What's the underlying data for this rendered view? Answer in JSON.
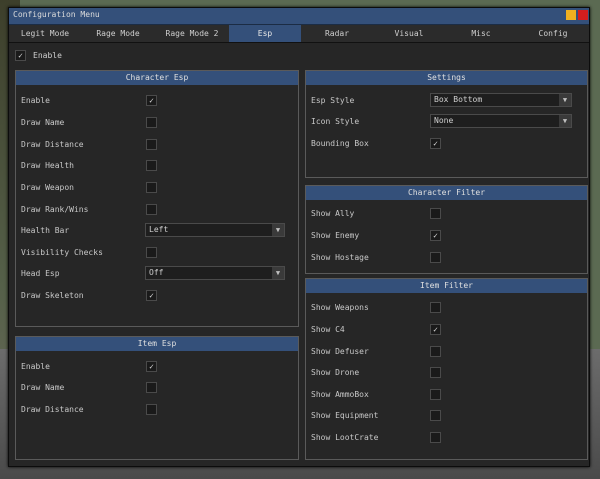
{
  "window": {
    "title": "Configuration Menu"
  },
  "tabs": [
    {
      "label": "Legit Mode"
    },
    {
      "label": "Rage Mode"
    },
    {
      "label": "Rage Mode 2"
    },
    {
      "label": "Esp"
    },
    {
      "label": "Radar"
    },
    {
      "label": "Visual"
    },
    {
      "label": "Misc"
    },
    {
      "label": "Config"
    }
  ],
  "active_tab": "Esp",
  "global_enable": {
    "label": "Enable",
    "checked": true
  },
  "character_esp": {
    "title": "Character Esp",
    "rows": [
      {
        "label": "Enable",
        "checked": true
      },
      {
        "label": "Draw Name",
        "checked": false
      },
      {
        "label": "Draw Distance",
        "checked": false
      },
      {
        "label": "Draw Health",
        "checked": false
      },
      {
        "label": "Draw Weapon",
        "checked": false
      },
      {
        "label": "Draw Rank/Wins",
        "checked": false
      },
      {
        "label": "Health Bar",
        "value": "Left"
      },
      {
        "label": "Visibility Checks",
        "checked": false
      },
      {
        "label": "Head Esp",
        "value": "Off"
      },
      {
        "label": "Draw Skeleton",
        "checked": true
      }
    ]
  },
  "item_esp": {
    "title": "Item Esp",
    "rows": [
      {
        "label": "Enable",
        "checked": true
      },
      {
        "label": "Draw Name",
        "checked": false
      },
      {
        "label": "Draw Distance",
        "checked": false
      }
    ]
  },
  "settings": {
    "title": "Settings",
    "rows": [
      {
        "label": "Esp Style",
        "value": "Box Bottom"
      },
      {
        "label": "Icon Style",
        "value": "None"
      },
      {
        "label": "Bounding Box",
        "checked": true
      }
    ]
  },
  "character_filter": {
    "title": "Character Filter",
    "rows": [
      {
        "label": "Show Ally",
        "checked": false
      },
      {
        "label": "Show Enemy",
        "checked": true
      },
      {
        "label": "Show Hostage",
        "checked": false
      }
    ]
  },
  "item_filter": {
    "title": "Item Filter",
    "rows": [
      {
        "label": "Show Weapons",
        "checked": false
      },
      {
        "label": "Show C4",
        "checked": true
      },
      {
        "label": "Show Defuser",
        "checked": false
      },
      {
        "label": "Show Drone",
        "checked": false
      },
      {
        "label": "Show AmmoBox",
        "checked": false
      },
      {
        "label": "Show Equipment",
        "checked": false
      },
      {
        "label": "Show LootCrate",
        "checked": false
      }
    ]
  },
  "icons": {
    "checkmark": "✓",
    "dropdown_arrow": "▼",
    "minimize_color": "#f0b020",
    "close_color": "#d41e1e"
  },
  "colors": {
    "accent": "#34507a",
    "panel": "#262626"
  }
}
